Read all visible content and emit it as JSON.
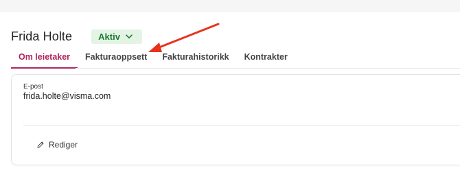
{
  "tenant": {
    "name": "Frida Holte",
    "status": "Aktiv"
  },
  "tabs": [
    {
      "label": "Om leietaker",
      "active": true
    },
    {
      "label": "Fakturaoppsett",
      "active": false
    },
    {
      "label": "Fakturahistorikk",
      "active": false
    },
    {
      "label": "Kontrakter",
      "active": false
    }
  ],
  "details": {
    "email_label": "E-post",
    "email_value": "frida.holte@visma.com",
    "edit_label": "Rediger"
  },
  "colors": {
    "accent": "#b0245e",
    "status_bg": "#e3f4e4",
    "status_text": "#1e7a35",
    "annotation_arrow": "#e8321e"
  },
  "icons": {
    "status_dropdown": "chevron-down-icon",
    "edit": "pencil-icon"
  }
}
